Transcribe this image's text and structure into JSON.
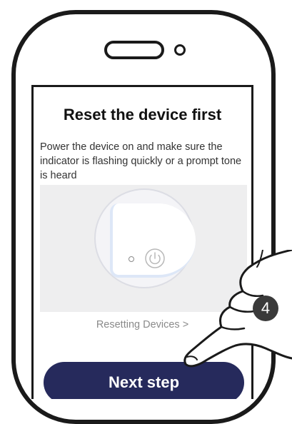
{
  "screen": {
    "title": "Reset the device first",
    "description": "Power the device on and make sure the indicator is flashing quickly or a prompt tone is heard",
    "reset_link": "Resetting Devices >",
    "next_button": "Next step"
  },
  "overlay": {
    "step_number": "4",
    "pointer_icon": "pointing-hand-icon"
  },
  "colors": {
    "button": "#262a5c",
    "frame": "#1a1a1a",
    "illustration_bg": "#eeeeef"
  }
}
